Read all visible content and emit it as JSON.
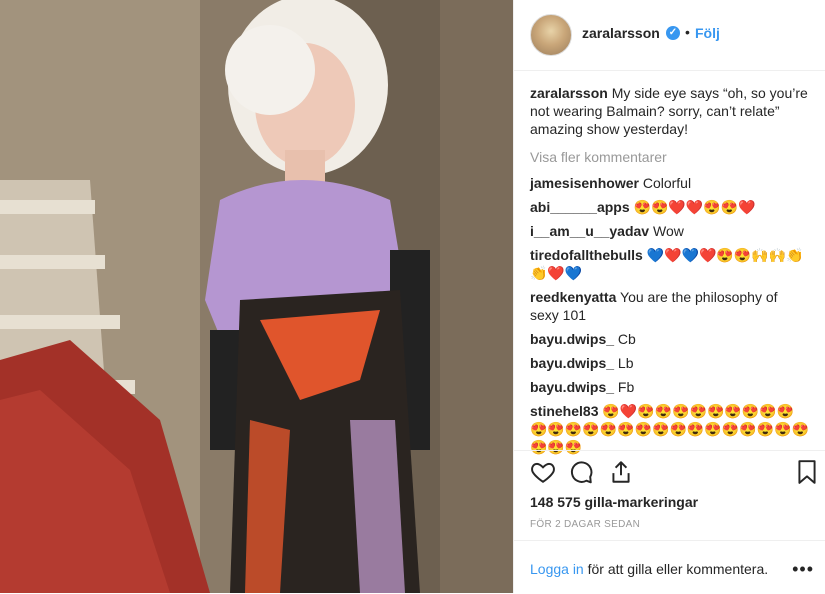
{
  "post": {
    "username": "zaralarsson",
    "verified_icon": "verified-badge-icon",
    "follow_label": "Följ",
    "dot": "•"
  },
  "caption": {
    "username": "zaralarsson",
    "text": "My side eye says “oh, so you’re not wearing Balmain? sorry, can’t relate” amazing show yesterday!"
  },
  "view_more": "Visa fler kommentarer",
  "comments": [
    {
      "user": "jamesisenhower",
      "text": "Colorful"
    },
    {
      "user": "abi______apps",
      "text": "😍😍❤️❤️😍😍❤️"
    },
    {
      "user": "i__am__u__yadav",
      "text": "Wow"
    },
    {
      "user": "tiredofallthebulls",
      "text": "💙❤️💙❤️😍😍🙌🙌👏👏❤️💙"
    },
    {
      "user": "reedkenyatta",
      "text": "You are the philosophy of sexy 101"
    },
    {
      "user": "bayu.dwips_",
      "text": "Cb"
    },
    {
      "user": "bayu.dwips_",
      "text": "Lb"
    },
    {
      "user": "bayu.dwips_",
      "text": "Fb"
    },
    {
      "user": "stinehel83",
      "text": "😍❤️😍😍😍😍😍😍😍😍😍😍😍😍😍😍😍😍😍😍😍😍😍😍😍😍😍😍😍😍"
    }
  ],
  "likes": "148 575 gilla-markeringar",
  "time": "FÖR 2 DAGAR SEDAN",
  "footer": {
    "login_link": "Logga in",
    "login_rest": " för att gilla eller kommentera.",
    "options": "•••"
  },
  "icons": {
    "like": "heart-icon",
    "comment": "comment-icon",
    "share": "share-icon",
    "save": "bookmark-icon"
  },
  "colors": {
    "accent": "#3897f0",
    "muted": "#999999",
    "text": "#262626"
  }
}
